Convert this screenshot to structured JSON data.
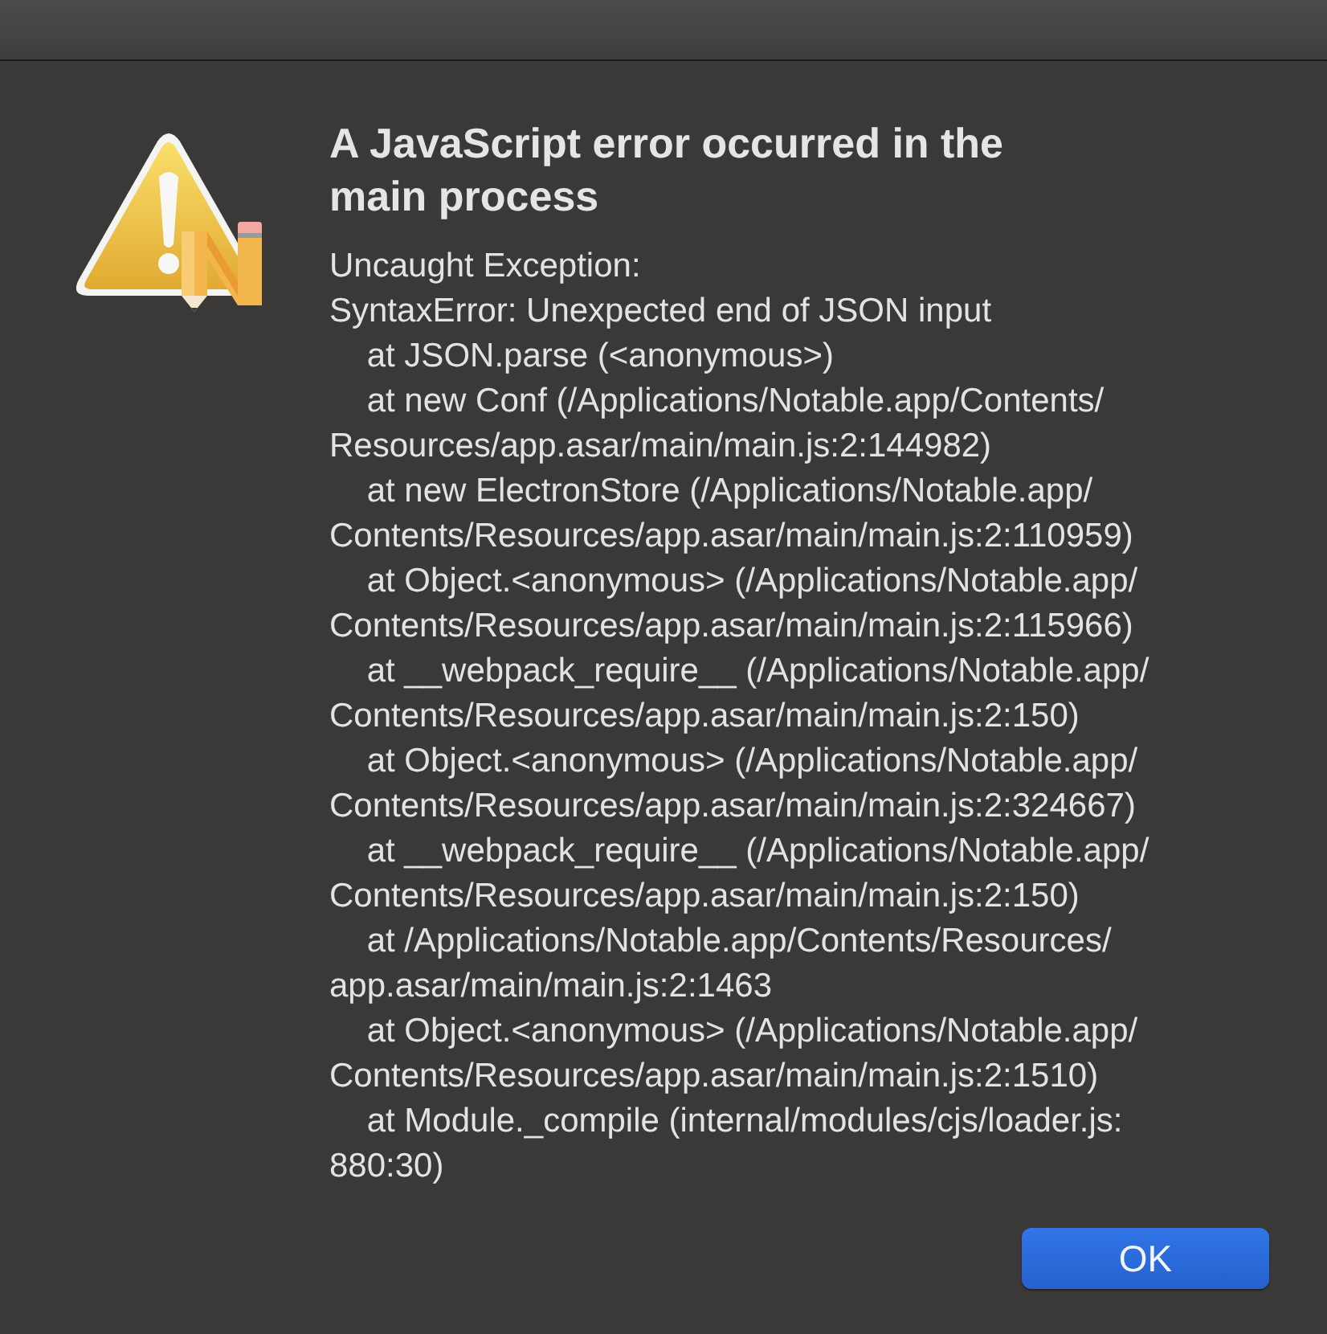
{
  "dialog": {
    "title": "A JavaScript error occurred in the main process",
    "message_lines": [
      "Uncaught Exception:",
      "SyntaxError: Unexpected end of JSON input",
      "    at JSON.parse (<anonymous>)",
      "    at new Conf (/Applications/Notable.app/Contents/",
      "Resources/app.asar/main/main.js:2:144982)",
      "    at new ElectronStore (/Applications/Notable.app/",
      "Contents/Resources/app.asar/main/main.js:2:110959)",
      "    at Object.<anonymous> (/Applications/Notable.app/",
      "Contents/Resources/app.asar/main/main.js:2:115966)",
      "    at __webpack_require__ (/Applications/Notable.app/",
      "Contents/Resources/app.asar/main/main.js:2:150)",
      "    at Object.<anonymous> (/Applications/Notable.app/",
      "Contents/Resources/app.asar/main/main.js:2:324667)",
      "    at __webpack_require__ (/Applications/Notable.app/",
      "Contents/Resources/app.asar/main/main.js:2:150)",
      "    at /Applications/Notable.app/Contents/Resources/",
      "app.asar/main/main.js:2:1463",
      "    at Object.<anonymous> (/Applications/Notable.app/",
      "Contents/Resources/app.asar/main/main.js:2:1510)",
      "    at Module._compile (internal/modules/cjs/loader.js:",
      "880:30)"
    ],
    "buttons": [
      {
        "label": "OK",
        "default": true
      }
    ]
  }
}
